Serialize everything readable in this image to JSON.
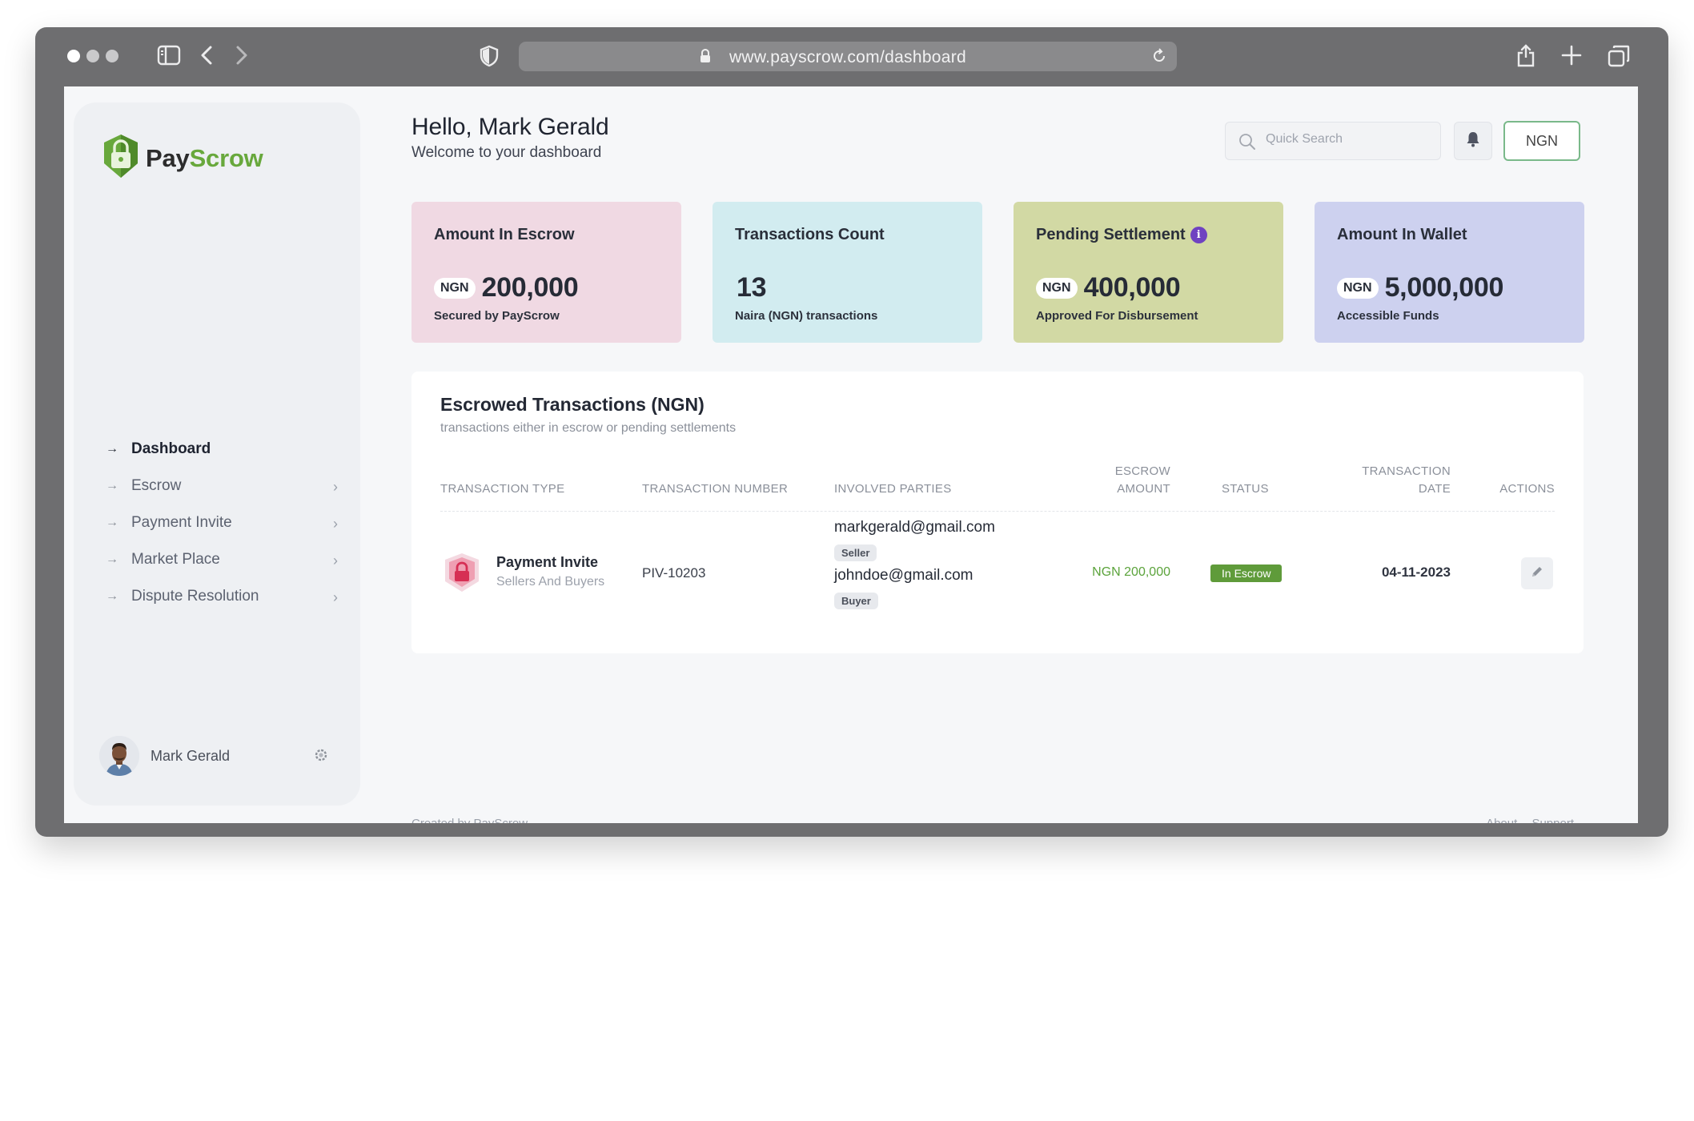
{
  "browser": {
    "url": "www.payscrow.com/dashboard"
  },
  "brand": {
    "name_part1": "Pay",
    "name_part2": "Scrow",
    "color_primary": "#68a83c"
  },
  "sidebar": {
    "items": [
      {
        "label": "Dashboard",
        "active": true,
        "has_chevron": false
      },
      {
        "label": "Escrow",
        "active": false,
        "has_chevron": true
      },
      {
        "label": "Payment Invite",
        "active": false,
        "has_chevron": true
      },
      {
        "label": "Market Place",
        "active": false,
        "has_chevron": true
      },
      {
        "label": "Dispute Resolution",
        "active": false,
        "has_chevron": true
      }
    ],
    "user": {
      "name": "Mark Gerald",
      "settings_icon": "gear-icon"
    }
  },
  "header": {
    "greeting": "Hello, Mark Gerald",
    "subtitle": "Welcome to your dashboard",
    "search_placeholder": "Quick Search",
    "notification_icon": "bell-icon",
    "currency": "NGN"
  },
  "cards": [
    {
      "title": "Amount In Escrow",
      "currency": "NGN",
      "value": "200,000",
      "sub": "Secured by PayScrow",
      "color": "#f0d9e3"
    },
    {
      "title": "Transactions Count",
      "currency": "",
      "value": "13",
      "sub": "Naira (NGN) transactions",
      "color": "#d2ecf0"
    },
    {
      "title": "Pending Settlement",
      "currency": "NGN",
      "value": "400,000",
      "sub": "Approved For Disbursement",
      "color": "#d2d9a4",
      "info_icon": "info-icon"
    },
    {
      "title": "Amount In Wallet",
      "currency": "NGN",
      "value": "5,000,000",
      "sub": "Accessible Funds",
      "color": "#cdd1ef"
    }
  ],
  "transactions": {
    "title": "Escrowed Transactions (NGN)",
    "subtitle": "transactions either in escrow or pending settlements",
    "columns": {
      "type": "TRANSACTION TYPE",
      "number": "TRANSACTION NUMBER",
      "parties": "INVOLVED PARTIES",
      "amount_line1": "ESCROW",
      "amount_line2": "AMOUNT",
      "status": "STATUS",
      "date_line1": "TRANSACTION",
      "date_line2": "DATE",
      "actions": "ACTIONS"
    },
    "rows": [
      {
        "type": "Payment Invite",
        "type_sub": "Sellers And Buyers",
        "number": "PIV-10203",
        "seller_email": "markgerald@gmail.com",
        "seller_role": "Seller",
        "buyer_email": "johndoe@gmail.com",
        "buyer_role": "Buyer",
        "amount": "NGN 200,000",
        "status": "In Escrow",
        "status_color": "#5f9b3a",
        "date": "04-11-2023",
        "action_icon": "pencil-icon"
      }
    ]
  },
  "footer": {
    "created_by": "Created by  PayScrow",
    "links": [
      "About",
      "Support"
    ]
  }
}
